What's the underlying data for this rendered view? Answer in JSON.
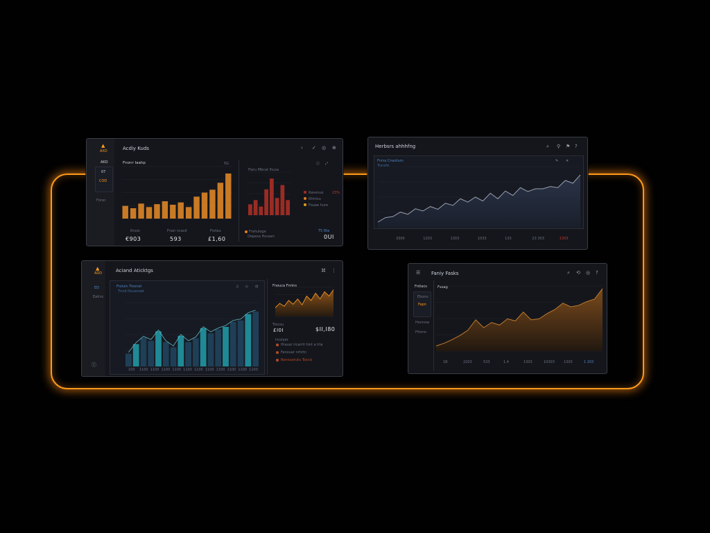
{
  "colors": {
    "orange": "#ff9a1c",
    "bar_orange": "#c97a25",
    "bar_red": "#9a2c24",
    "teal": "#1f8a96",
    "navy": "#1f3f57",
    "panel": "#14161c"
  },
  "panel1": {
    "title": "Acdiy Kuds",
    "logo_text": "AXD",
    "side_items": [
      "AKD",
      "07",
      "COD"
    ],
    "side_extra": "Fonsr",
    "chart_title": "Fnonr Iaahp",
    "chart_sub": "5G",
    "stats": [
      {
        "label": "Rnoiz",
        "value": "€903"
      },
      {
        "label": "Fnan ncasit",
        "value": "593"
      },
      {
        "label": "Frotau",
        "value": "£1,60"
      }
    ],
    "right_title": "Fiaru Mbcat Ihusa",
    "legend": [
      "Ravenus",
      "Rhtrisu",
      "Fouae hure"
    ],
    "legend_values": [
      "23%",
      "",
      ""
    ],
    "footer_left": "Frahuloge",
    "footer_sub": "Oopesa Huraan",
    "footer_value": "0UI",
    "footer_small": "T5 Rte"
  },
  "panel2": {
    "title": "Herbsrs ahhhfng",
    "sub_title": "Fnrss Cnaotum",
    "sub_sub": "Trarafo",
    "x_labels": [
      "3300",
      "1203",
      "1303",
      "1033",
      "133",
      "23 303",
      "1303"
    ]
  },
  "panel3": {
    "title": "Aciand Aticktgs",
    "logo_text": "ADD",
    "side_items": [
      "ED",
      "Eatinc"
    ],
    "chart_title": "Froiuin Trosnet",
    "chart_sub": "Tnnd Ifuuanoet",
    "right_title": "Fnouca Fnrins",
    "mid_label": "Trocou",
    "mid_value": "£I0I",
    "mid_value2": "$II,I80",
    "list_title": "Ircolyer",
    "list": [
      "Ifrauar ircarrit hint a hta",
      "Fanouar nrhrtn",
      "Ronouorutu   Toscis"
    ],
    "x_labels": [
      "100",
      "1100",
      "1100",
      "1100",
      "1100",
      "1100",
      "1100",
      "1100",
      "1100",
      "1100",
      "1100",
      "1100"
    ]
  },
  "panel4": {
    "title": "Faniy Fasks",
    "side_title": "Fntlacs",
    "side_items": [
      "Ebonu",
      "Fapn",
      "Honnow",
      "Fthmn"
    ],
    "chart_title": "Fsoag",
    "x_labels": [
      "1B",
      "2203",
      "533",
      "1.4",
      "1303",
      "10303",
      "1303",
      "1 203"
    ]
  },
  "chart_data": [
    {
      "type": "bar",
      "title": "Fnonr Iaahp",
      "values": [
        22,
        18,
        26,
        20,
        25,
        30,
        24,
        28,
        20,
        38,
        45,
        50,
        62,
        78
      ]
    },
    {
      "type": "bar",
      "title": "Fiaru Mbcat Ihusa",
      "values": [
        25,
        35,
        20,
        60,
        85,
        40,
        70,
        35
      ]
    },
    {
      "type": "area",
      "title": "Herbsrs ahhhfng",
      "values": [
        10,
        18,
        20,
        28,
        24,
        34,
        30,
        38,
        33,
        44,
        40,
        52,
        46,
        55,
        48,
        62,
        52,
        66,
        58,
        72,
        65,
        70,
        70,
        74,
        72,
        85,
        80,
        95
      ]
    },
    {
      "type": "bar",
      "title": "Froiuin Trosnet",
      "values": [
        20,
        35,
        45,
        40,
        55,
        38,
        30,
        48,
        38,
        44,
        60,
        52,
        58,
        62,
        70,
        72,
        82,
        86
      ]
    },
    {
      "type": "area",
      "title": "Fnouca Fnrins",
      "values": [
        30,
        45,
        35,
        55,
        42,
        60,
        40,
        70,
        55,
        80,
        60,
        85,
        70,
        92
      ]
    },
    {
      "type": "area",
      "title": "Fsoag",
      "values": [
        10,
        15,
        22,
        30,
        40,
        60,
        45,
        55,
        50,
        62,
        58,
        75,
        60,
        62,
        72,
        80,
        92,
        85,
        88,
        95,
        100,
        120
      ]
    }
  ]
}
